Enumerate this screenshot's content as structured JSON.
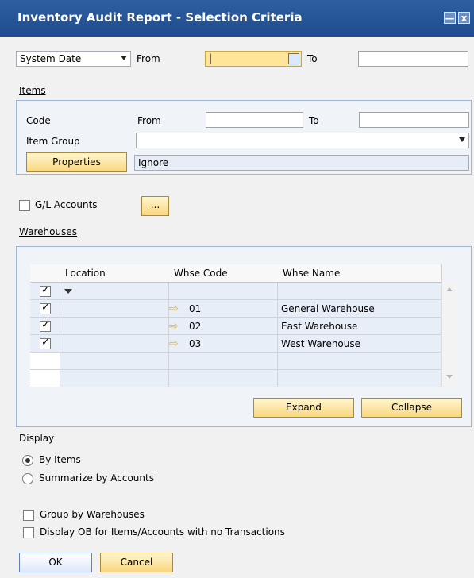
{
  "window": {
    "title": "Inventory Audit Report - Selection Criteria",
    "min_label": "—",
    "close_label": "x"
  },
  "date": {
    "type_value": "System Date",
    "from_label": "From",
    "to_label": "To"
  },
  "items": {
    "section_label": "Items",
    "code_label": "Code",
    "from_label": "From",
    "to_label": "To",
    "item_group_label": "Item Group",
    "properties_label": "Properties",
    "properties_value": "Ignore"
  },
  "gl": {
    "label": "G/L Accounts",
    "button_label": "..."
  },
  "warehouses": {
    "section_label": "Warehouses",
    "columns": [
      "Location",
      "Whse Code",
      "Whse Name"
    ],
    "rows": [
      {
        "code": "01",
        "name": "General Warehouse"
      },
      {
        "code": "02",
        "name": "East Warehouse"
      },
      {
        "code": "03",
        "name": "West Warehouse"
      }
    ],
    "expand_label": "Expand",
    "collapse_label": "Collapse"
  },
  "display": {
    "label": "Display",
    "option_items": "By Items",
    "option_accounts": "Summarize by Accounts",
    "group_by_warehouses": "Group by Warehouses",
    "display_ob": "Display OB for Items/Accounts with no Transactions"
  },
  "footer": {
    "ok_label": "OK",
    "cancel_label": "Cancel"
  },
  "colors": {
    "title_bar": "#2f5fa0",
    "button_yellow": "#f9d77e",
    "highlight": "#ffe59a"
  }
}
